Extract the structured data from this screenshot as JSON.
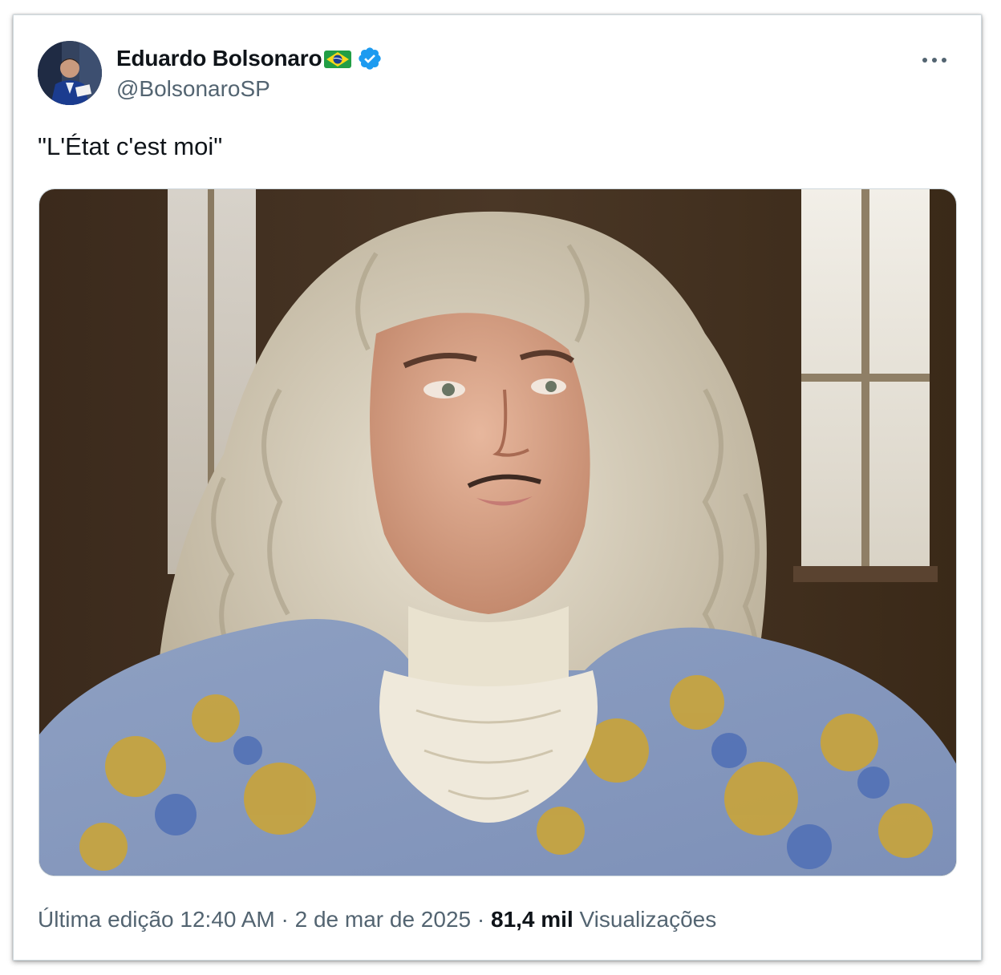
{
  "tweet": {
    "author": {
      "display_name": "Eduardo Bolsonaro",
      "handle": "@BolsonaroSP",
      "flag": "brazil-flag-emoji",
      "verified": true
    },
    "text": "\"L'État c'est moi\"",
    "media_alt": "",
    "meta": {
      "edited_label": "Última edição 12:40 AM",
      "separator": "·",
      "date": "2 de mar de 2025",
      "views_count": "81,4 mil",
      "views_label": "Visualizações"
    }
  },
  "colors": {
    "text_primary": "#0f1419",
    "text_secondary": "#536471",
    "verified_blue": "#1d9bf0",
    "border": "#cfd9de"
  }
}
